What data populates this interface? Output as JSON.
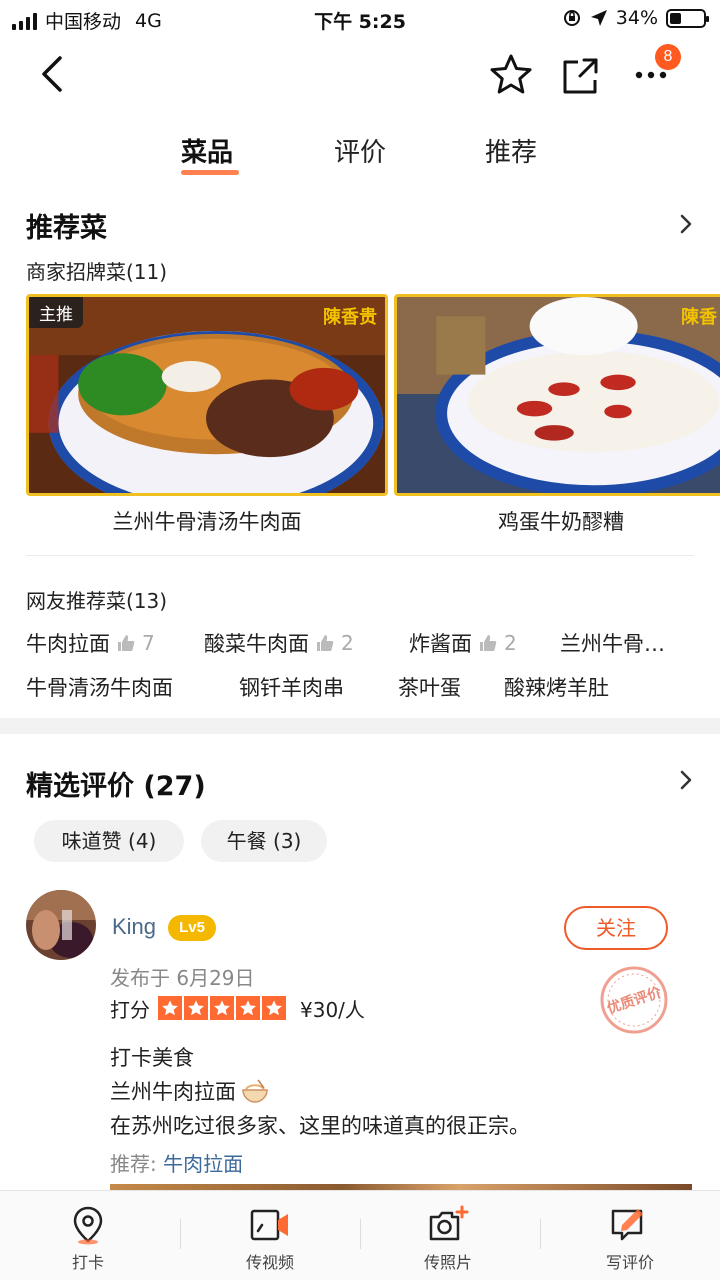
{
  "status_bar": {
    "carrier": "中国移动",
    "network": "4G",
    "time": "下午 5:25",
    "battery": "34%",
    "battery_level": 0.34
  },
  "nav": {
    "icons": [
      "back-icon",
      "star-icon",
      "share-icon",
      "more-icon"
    ],
    "more_badge": "8"
  },
  "tabs": [
    {
      "label": "菜品",
      "active": true
    },
    {
      "label": "评价",
      "active": false
    },
    {
      "label": "推荐",
      "active": false
    }
  ],
  "recommended": {
    "title": "推荐菜",
    "signature_label": "商家招牌菜(11)",
    "dishes": [
      {
        "name": "兰州牛骨清汤牛肉面",
        "tag": "主推",
        "brand": "陳香贵"
      },
      {
        "name": "鸡蛋牛奶醪糟",
        "brand": "陳香"
      }
    ],
    "netizen_label": "网友推荐菜(13)",
    "netizen_items": [
      {
        "name": "牛肉拉面",
        "likes": "7"
      },
      {
        "name": "酸菜牛肉面",
        "likes": "2"
      },
      {
        "name": "炸酱面",
        "likes": "2"
      },
      {
        "name": "兰州牛骨…"
      },
      {
        "name": "牛骨清汤牛肉面"
      },
      {
        "name": "钢钎羊肉串"
      },
      {
        "name": "茶叶蛋"
      },
      {
        "name": "酸辣烤羊肚"
      }
    ]
  },
  "reviews": {
    "title": "精选评价 (27)",
    "filters": [
      "味道赞 (4)",
      "午餐 (3)"
    ],
    "item": {
      "user": "King",
      "level": "Lv5",
      "follow": "关注",
      "posted": "发布于 6月29日",
      "score_label": "打分",
      "stars": 5,
      "price": "¥30/人",
      "stamp": "优质评价",
      "lines": [
        "打卡美食",
        "兰州牛肉拉面",
        "在苏州吃过很多家、这里的味道真的很正宗。"
      ],
      "rec_prefix": "推荐:",
      "rec_dish": "牛肉拉面"
    }
  },
  "bottom_bar": [
    {
      "label": "打卡",
      "icon": "location-pin-icon"
    },
    {
      "label": "传视频",
      "icon": "video-upload-icon"
    },
    {
      "label": "传照片",
      "icon": "camera-add-icon"
    },
    {
      "label": "写评价",
      "icon": "write-review-icon"
    }
  ],
  "colors": {
    "accent": "#ff6a33",
    "link": "#4a6a8a",
    "badge": "#f4b800",
    "card_border": "#f0c020"
  }
}
